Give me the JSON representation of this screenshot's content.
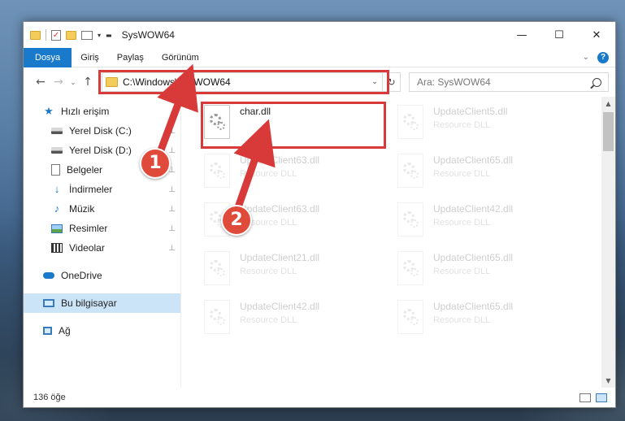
{
  "window": {
    "title": "SysWOW64",
    "controls": {
      "minimize": "—",
      "maximize": "☐",
      "close": "✕"
    }
  },
  "ribbon": {
    "tabs": [
      "Dosya",
      "Giriş",
      "Paylaş",
      "Görünüm"
    ],
    "active_tab": "Dosya",
    "expand_glyph": "⌄",
    "help_glyph": "?"
  },
  "address": {
    "path": "C:\\Windows\\SysWOW64",
    "search_placeholder": "Ara: SysWOW64",
    "back_glyph": "←",
    "forward_glyph": "→",
    "recent_glyph": "⌄",
    "up_glyph": "↑",
    "dropdown_glyph": "⌄",
    "refresh_glyph": "↻"
  },
  "nav": {
    "quick_access": "Hızlı erişim",
    "items": [
      {
        "label": "Yerel Disk (C:)",
        "icon": "drive-icon",
        "pinned": true
      },
      {
        "label": "Yerel Disk (D:)",
        "icon": "drive-icon",
        "pinned": true
      },
      {
        "label": "Belgeler",
        "icon": "documents-icon",
        "pinned": true
      },
      {
        "label": "İndirmeler",
        "icon": "downloads-icon",
        "pinned": true
      },
      {
        "label": "Müzik",
        "icon": "music-icon",
        "pinned": true
      },
      {
        "label": "Resimler",
        "icon": "pictures-icon",
        "pinned": true
      },
      {
        "label": "Videolar",
        "icon": "videos-icon",
        "pinned": true
      }
    ],
    "onedrive": "OneDrive",
    "this_pc": "Bu bilgisayar",
    "network": "Ağ",
    "pin_glyph": "📌"
  },
  "files": [
    {
      "name": "char.dll",
      "desc": "",
      "highlighted": true
    },
    {
      "name": "UpdateClient5.dll",
      "desc": "Resource DLL",
      "highlighted": false
    },
    {
      "name": "UpdateClient63.dll",
      "desc": "Resource DLL",
      "highlighted": false
    },
    {
      "name": "UpdateClient65.dll",
      "desc": "Resource DLL",
      "highlighted": false
    },
    {
      "name": "UpdateClient63.dll",
      "desc": "Resource DLL",
      "highlighted": false
    },
    {
      "name": "UpdateClient42.dll",
      "desc": "Resource DLL",
      "highlighted": false
    },
    {
      "name": "UpdateClient21.dll",
      "desc": "Resource DLL",
      "highlighted": false
    },
    {
      "name": "UpdateClient65.dll",
      "desc": "Resource DLL",
      "highlighted": false
    },
    {
      "name": "UpdateClient42.dll",
      "desc": "Resource DLL",
      "highlighted": false
    },
    {
      "name": "UpdateClient65.dll",
      "desc": "Resource DLL",
      "highlighted": false
    }
  ],
  "status": {
    "item_count": "136 öğe"
  },
  "annotations": {
    "step1": "1",
    "step2": "2",
    "color": "#d83a3a"
  }
}
